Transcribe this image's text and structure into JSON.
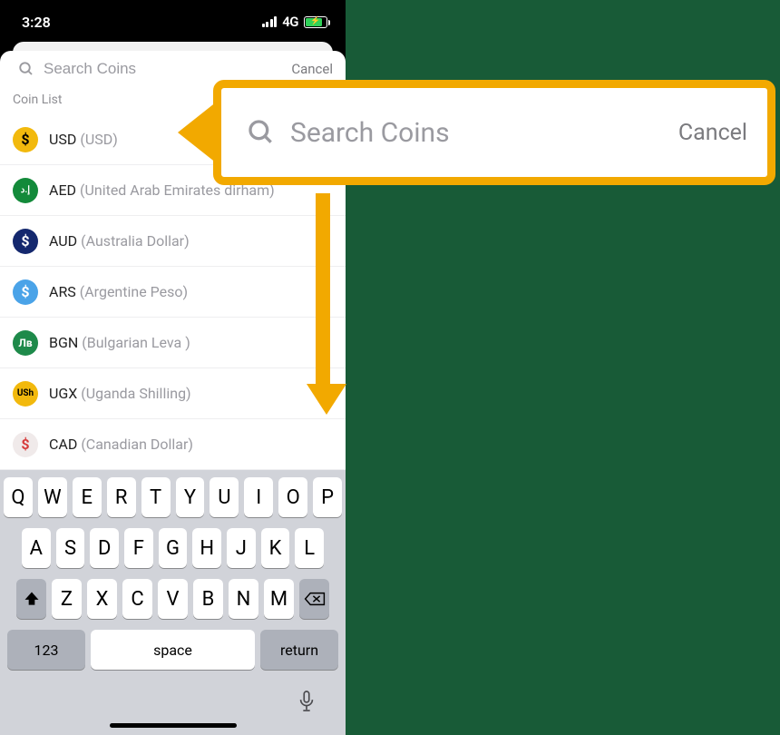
{
  "status": {
    "time": "3:28",
    "carrier": "4G"
  },
  "search": {
    "placeholder": "Search Coins",
    "cancel": "Cancel"
  },
  "section_header": "Coin List",
  "coins": [
    {
      "code": "USD",
      "name": "(USD)",
      "icon_bg": "#f2b90d",
      "icon_fg": "#000000",
      "glyph": "$"
    },
    {
      "code": "AED",
      "name": "(United Arab Emirates dirham)",
      "icon_bg": "#138a3a",
      "icon_fg": "#ffffff",
      "glyph": "إ.د"
    },
    {
      "code": "AUD",
      "name": "(Australia Dollar)",
      "icon_bg": "#14286e",
      "icon_fg": "#ffffff",
      "glyph": "$"
    },
    {
      "code": "ARS",
      "name": "(Argentine Peso)",
      "icon_bg": "#4aa3e8",
      "icon_fg": "#ffffff",
      "glyph": "$"
    },
    {
      "code": "BGN",
      "name": "(Bulgarian Leva )",
      "icon_bg": "#1e8a4a",
      "icon_fg": "#ffffff",
      "glyph": "Лв"
    },
    {
      "code": "UGX",
      "name": "(Uganda Shilling)",
      "icon_bg": "#f2b90d",
      "icon_fg": "#000000",
      "glyph": "USh"
    },
    {
      "code": "CAD",
      "name": "(Canadian Dollar)",
      "icon_bg": "#f0eaea",
      "icon_fg": "#d63a3a",
      "glyph": "$"
    }
  ],
  "keyboard": {
    "row1": [
      "Q",
      "W",
      "E",
      "R",
      "T",
      "Y",
      "U",
      "I",
      "O",
      "P"
    ],
    "row2": [
      "A",
      "S",
      "D",
      "F",
      "G",
      "H",
      "J",
      "K",
      "L"
    ],
    "row3": [
      "Z",
      "X",
      "C",
      "V",
      "B",
      "N",
      "M"
    ],
    "numeric": "123",
    "space": "space",
    "ret": "return"
  },
  "callout": {
    "placeholder": "Search Coins",
    "cancel": "Cancel"
  }
}
